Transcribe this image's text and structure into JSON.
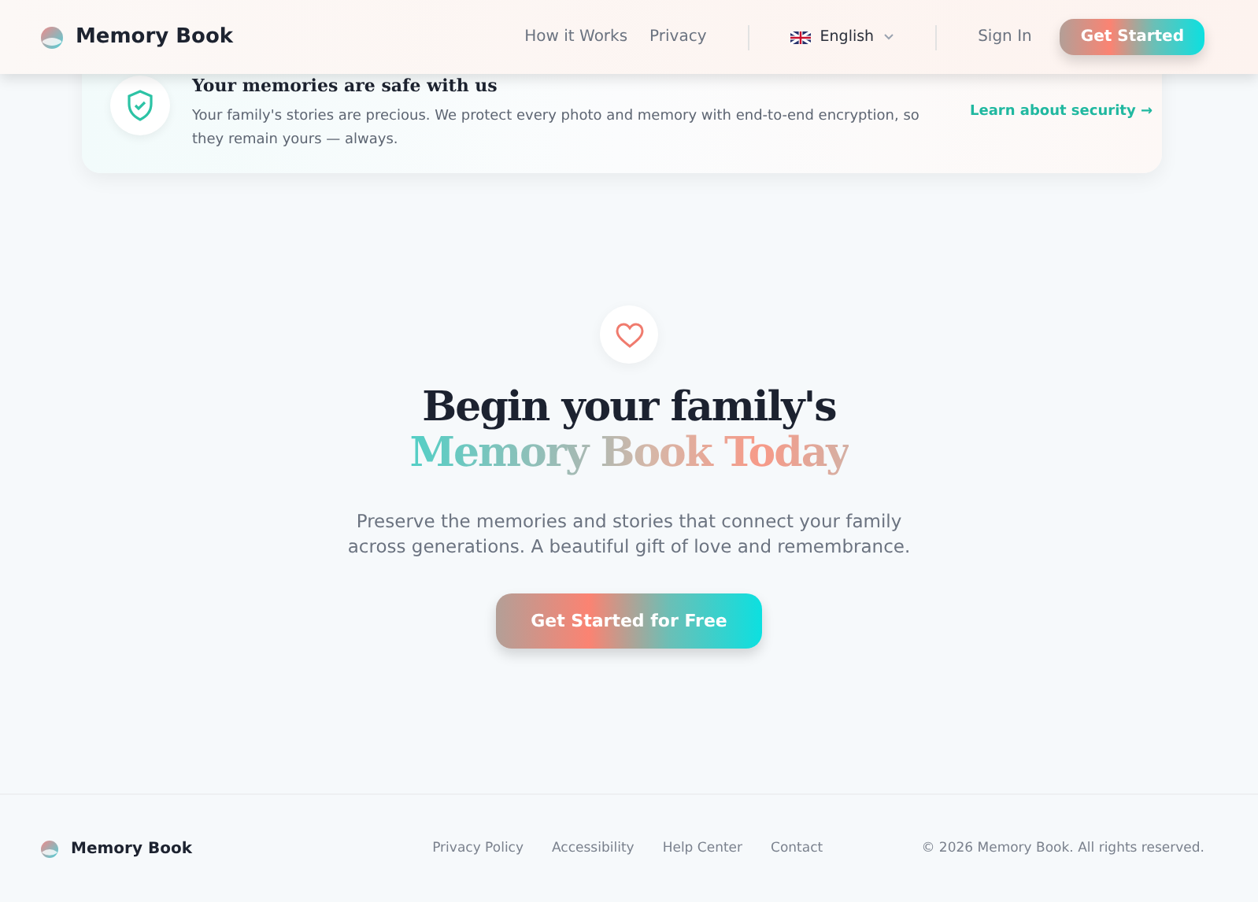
{
  "header": {
    "brand": "Memory Book",
    "nav": [
      "How it Works",
      "Privacy"
    ],
    "language": {
      "label": "English"
    },
    "sign_in": "Sign In",
    "cta": "Get Started"
  },
  "notice": {
    "title": "Your memories are safe with us",
    "text": "Your family's stories are precious. We protect every photo and memory with end-to-end encryption, so they remain yours — always.",
    "link": "Learn about security",
    "link_icon": "→"
  },
  "hero": {
    "title_line1": "Begin your family's",
    "title_line2": "Memory Book Today",
    "subtitle": "Preserve the memories and stories that connect your family across generations. A beautiful gift of love and remembrance.",
    "button": "Get Started for Free"
  },
  "footer": {
    "brand": "Memory Book",
    "links": [
      "Privacy Policy",
      "Accessibility",
      "Help Center",
      "Contact"
    ],
    "copyright": "© 2026 Memory Book. All rights reserved."
  }
}
